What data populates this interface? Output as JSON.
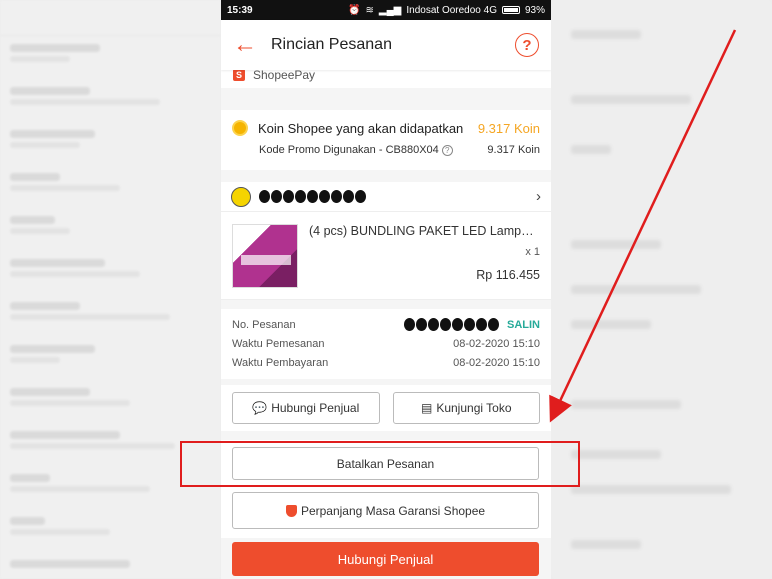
{
  "status_bar": {
    "time": "15:39",
    "carrier": "Indosat Ooredoo 4G",
    "battery": "93%"
  },
  "app_bar": {
    "back_icon": "arrow-left-icon",
    "title": "Rincian Pesanan",
    "help": "?"
  },
  "payment": {
    "method": "ShopeePay"
  },
  "coins": {
    "label": "Koin Shopee yang akan didapatkan",
    "amount": "9.317 Koin",
    "promo_label": "Kode Promo Digunakan - CB880X04",
    "promo_value": "9.317 Koin"
  },
  "product": {
    "name": "(4 pcs) BUNDLING PAKET LED Lampu Bohlam",
    "qty": "x 1",
    "price": "Rp 116.455"
  },
  "order": {
    "no_label": "No. Pesanan",
    "copy_label": "SALIN",
    "order_time_label": "Waktu Pemesanan",
    "order_time": "08-02-2020 15:10",
    "pay_time_label": "Waktu Pembayaran",
    "pay_time": "08-02-2020 15:10"
  },
  "buttons": {
    "chat_seller": "Hubungi Penjual",
    "visit_shop": "Kunjungi Toko",
    "cancel_order": "Batalkan Pesanan",
    "extend_warranty": "Perpanjang Masa Garansi Shopee",
    "primary_chat": "Hubungi Penjual"
  },
  "colors": {
    "brand": "#ee4d2d",
    "coin": "#f5a623",
    "copy": "#26aa99",
    "annotation": "#e01d1d"
  }
}
